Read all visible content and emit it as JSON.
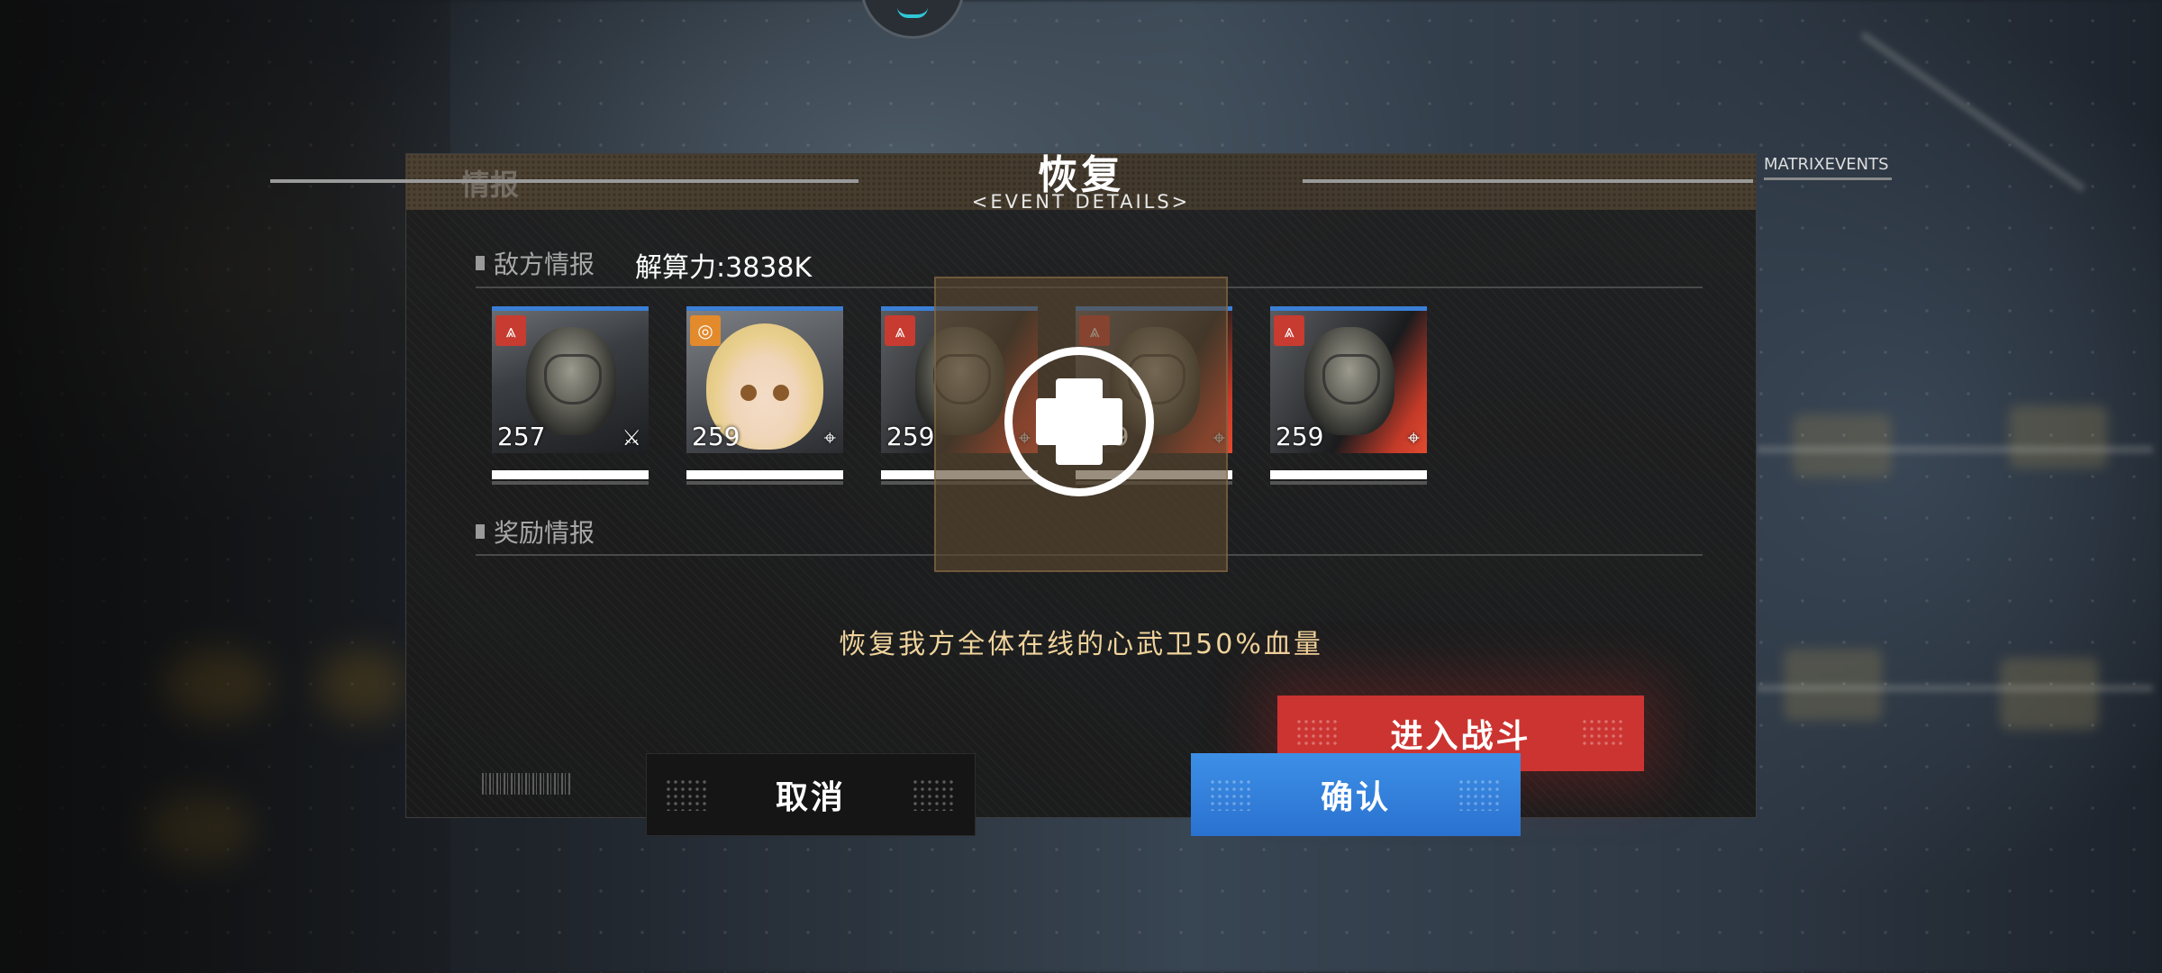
{
  "dialog": {
    "title": "恢复",
    "subtitle": "<EVENT DETAILS>",
    "corner_tag": "MATRIXEVENTS",
    "ghost_heading": "情报"
  },
  "enemy": {
    "section_label": "敌方情报",
    "power_label": "解算力:3838K",
    "cards": [
      {
        "level": "257",
        "badge_icon": "enemy-type-icon",
        "role_icon": "crossed-blades-icon",
        "portrait": "armored-soldier",
        "hp_fraction": 1.0
      },
      {
        "level": "259",
        "badge_icon": "enemy-type-icon",
        "role_icon": "target-reticle-icon",
        "portrait": "blonde-girl",
        "hp_fraction": 1.0
      },
      {
        "level": "259",
        "badge_icon": "enemy-type-icon",
        "role_icon": "target-reticle-icon",
        "portrait": "armored-soldier-red",
        "hp_fraction": 1.0
      },
      {
        "level": "259",
        "badge_icon": "enemy-type-icon",
        "role_icon": "target-reticle-icon",
        "portrait": "armored-soldier-red",
        "hp_fraction": 1.0
      },
      {
        "level": "259",
        "badge_icon": "enemy-type-icon",
        "role_icon": "target-reticle-icon",
        "portrait": "armored-soldier-red",
        "hp_fraction": 1.0
      }
    ]
  },
  "reward": {
    "section_label": "奖励情报"
  },
  "event_description": "恢复我方全体在线的心武卫50%血量",
  "buttons": {
    "battle": "进入战斗",
    "cancel": "取消",
    "confirm": "确认"
  },
  "colors": {
    "accent_blue": "#2a72d0",
    "battle_red": "#cc3431",
    "description_gold": "#f0d49c"
  }
}
